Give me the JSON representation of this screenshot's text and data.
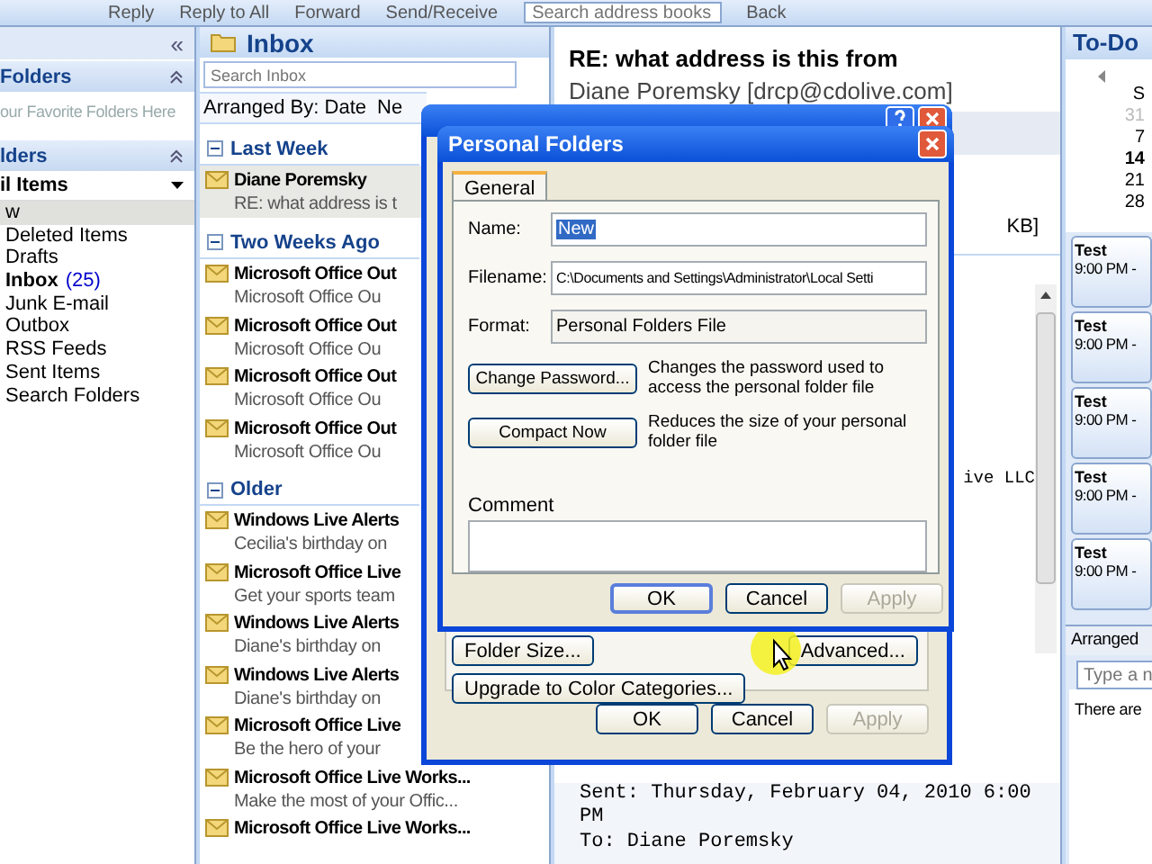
{
  "toolbar": {
    "buttons": [
      {
        "label": "Reply"
      },
      {
        "label": "Reply to All"
      },
      {
        "label": "Forward"
      },
      {
        "label": "Send/Receive"
      }
    ],
    "search": {
      "placeholder": "Search address books"
    },
    "back": "Back"
  },
  "navigation": {
    "collapse": "«",
    "favorites_header": "Folders",
    "favorites_hint": "our Favorite Folders Here",
    "folders_header": "lders",
    "mail_header": "il Items",
    "folders": [
      {
        "label": "w",
        "selected": true
      },
      {
        "label": "Deleted Items",
        "selected": false
      },
      {
        "label": "Drafts",
        "selected": false
      },
      {
        "label": "Inbox",
        "count": "(25)",
        "selected": false
      },
      {
        "label": "Junk E-mail",
        "selected": false
      },
      {
        "label": "Outbox",
        "selected": false
      },
      {
        "label": "RSS Feeds",
        "selected": false
      },
      {
        "label": "Sent Items",
        "selected": false
      },
      {
        "label": "Search Folders",
        "selected": false
      }
    ]
  },
  "message_list": {
    "title": "Inbox",
    "search": {
      "placeholder": "Search Inbox"
    },
    "arranged_by": "Arranged By: Date",
    "column_2": "Ne",
    "groups": [
      {
        "label": "Last Week",
        "messages": [
          {
            "sender": "Diane Poremsky",
            "preview": "RE: what address is t",
            "selected": true
          }
        ]
      },
      {
        "label": "Two Weeks Ago",
        "messages": [
          {
            "sender": "Microsoft Office Out",
            "preview": "Microsoft Office Ou",
            "selected": false
          },
          {
            "sender": "Microsoft Office Out",
            "preview": "Microsoft Office Ou",
            "selected": false
          },
          {
            "sender": "Microsoft Office Out",
            "preview": "Microsoft Office Ou",
            "selected": false
          },
          {
            "sender": "Microsoft Office Out",
            "preview": "Microsoft Office Ou",
            "selected": false
          }
        ]
      },
      {
        "label": "Older",
        "messages": [
          {
            "sender": "Windows Live Alerts",
            "preview": "Cecilia's birthday on",
            "selected": false
          },
          {
            "sender": "Microsoft Office Live",
            "preview": "Get your sports team",
            "selected": false
          },
          {
            "sender": "Windows Live Alerts",
            "preview": "Diane's birthday on",
            "selected": false
          },
          {
            "sender": "Windows Live Alerts",
            "preview": "Diane's birthday on",
            "selected": false
          },
          {
            "sender": "Microsoft Office Live",
            "preview": "Be the hero of your",
            "selected": false
          },
          {
            "sender": "Microsoft Office Live Works...",
            "preview": "Make the most of your Offic...",
            "selected": false
          },
          {
            "sender": "Microsoft Office Live Works...",
            "selected": false
          }
        ]
      }
    ]
  },
  "reading_pane": {
    "subject": "RE: what address is this from",
    "from": "Diane Poremsky [drcp@cdolive.com]",
    "size": "KB]",
    "body_fragment": "ive LLC",
    "header_lines": [
      "Sent: Thursday, February 04, 2010 6:00",
      "PM",
      "To: Diane Poremsky"
    ]
  },
  "todo_bar": {
    "title": "To-Do",
    "calendar": {
      "day_header": "S",
      "days": [
        {
          "label": "31",
          "bold": false
        },
        {
          "label": "7",
          "bold": false
        },
        {
          "label": "14",
          "bold": true
        },
        {
          "label": "21",
          "bold": false
        },
        {
          "label": "28",
          "bold": false
        }
      ]
    },
    "appointments": [
      {
        "title": "Test",
        "time": "9:00 PM -"
      },
      {
        "title": "Test",
        "time": "9:00 PM -"
      },
      {
        "title": "Test",
        "time": "9:00 PM -"
      },
      {
        "title": "Test",
        "time": "9:00 PM -"
      },
      {
        "title": "Test",
        "time": "9:00 PM -"
      }
    ],
    "arranged": "Arranged",
    "task_input": {
      "placeholder": "Type a n"
    },
    "empty_text": "There are"
  },
  "properties_dialog": {
    "buttons": [
      {
        "label": "Folder Size...",
        "disabled": false
      },
      {
        "label": "Upgrade to Color Categories...",
        "disabled": false
      },
      {
        "label": "Advanced...",
        "disabled": false
      }
    ],
    "footer": [
      {
        "label": "OK",
        "disabled": false
      },
      {
        "label": "Cancel",
        "disabled": false
      },
      {
        "label": "Apply",
        "disabled": true
      }
    ]
  },
  "personal_folders_dialog": {
    "title": "Personal Folders",
    "tabs": [
      {
        "label": "General",
        "selected": true
      }
    ],
    "name_label": "Name:",
    "name_value": "New",
    "filename_label": "Filename:",
    "filename_value": "C:\\Documents and Settings\\Administrator\\Local Setti",
    "format_label": "Format:",
    "format_value": "Personal Folders File",
    "actions": [
      {
        "label": "Change Password...",
        "description": "Changes the password used to access the personal folder file"
      },
      {
        "label": "Compact Now",
        "description": "Reduces the size of your personal folder file"
      }
    ],
    "comment_label": "Comment",
    "footer": [
      {
        "label": "OK",
        "disabled": false
      },
      {
        "label": "Cancel",
        "disabled": false
      },
      {
        "label": "Apply",
        "disabled": true
      }
    ]
  }
}
